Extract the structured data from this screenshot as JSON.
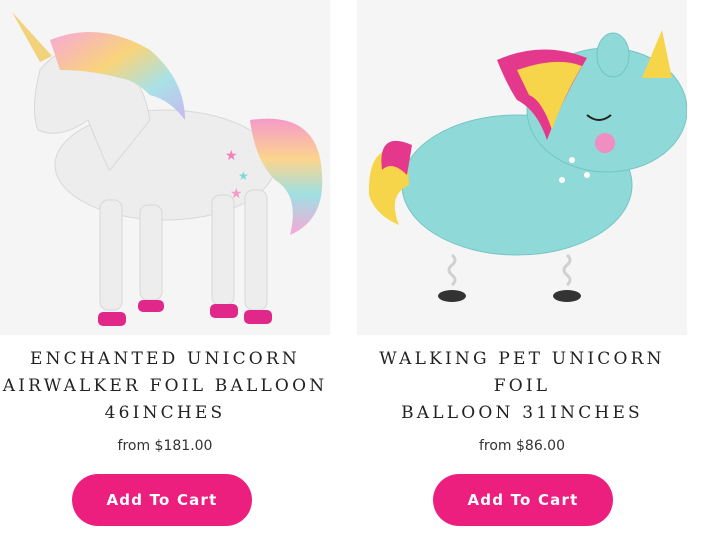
{
  "products": [
    {
      "title_lines": [
        "ENCHANTED UNICORN",
        "AIRWALKER FOIL BALLOON",
        "46INCHES"
      ],
      "price": "from $181.00",
      "button_label": "Add To Cart",
      "image_icon": "white-rainbow-unicorn-airwalker-image"
    },
    {
      "title_lines": [
        "WALKING PET UNICORN FOIL",
        "BALLOON 31INCHES"
      ],
      "price": "from $86.00",
      "button_label": "Add To Cart",
      "image_icon": "mint-unicorn-walking-pet-image"
    }
  ],
  "colors": {
    "button": "#ec1f7f",
    "image_bg": "#f5f5f5"
  }
}
